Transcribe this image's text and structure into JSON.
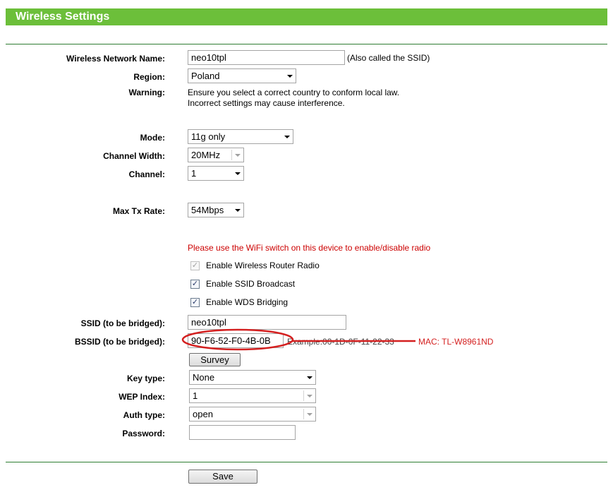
{
  "header": {
    "title": "Wireless Settings"
  },
  "fields": {
    "ssid_label": "Wireless Network Name:",
    "ssid_value": "neo10tpl",
    "ssid_hint": "(Also called the SSID)",
    "region_label": "Region:",
    "region_value": "Poland",
    "warning_label": "Warning:",
    "warning_line1": "Ensure you select a correct country to conform local law.",
    "warning_line2": "Incorrect settings may cause interference.",
    "mode_label": "Mode:",
    "mode_value": "11g only",
    "channel_width_label": "Channel Width:",
    "channel_width_value": "20MHz",
    "channel_label": "Channel:",
    "channel_value": "1",
    "max_tx_label": "Max Tx Rate:",
    "max_tx_value": "54Mbps",
    "wifi_switch_note": "Please use the WiFi switch on this device to enable/disable radio",
    "enable_radio_label": "Enable Wireless Router Radio",
    "enable_ssid_broadcast_label": "Enable SSID Broadcast",
    "enable_wds_label": "Enable WDS Bridging",
    "bridged_ssid_label": "SSID (to be bridged):",
    "bridged_ssid_value": "neo10tpl",
    "bssid_label": "BSSID (to be bridged):",
    "bssid_value": "90-F6-52-F0-4B-0B",
    "bssid_example": "Example:00-1D-0F-11-22-33",
    "survey_label": "Survey",
    "key_type_label": "Key type:",
    "key_type_value": "None",
    "wep_index_label": "WEP Index:",
    "wep_index_value": "1",
    "auth_type_label": "Auth type:",
    "auth_type_value": "open",
    "password_label": "Password:",
    "password_value": ""
  },
  "annotation": {
    "mac_note": "MAC: TL-W8961ND",
    "color": "#d42020"
  },
  "footer": {
    "save_label": "Save"
  },
  "checkboxes": {
    "enable_radio": true,
    "enable_ssid_broadcast": true,
    "enable_wds": true
  },
  "colors": {
    "header": "#6cbf3a",
    "divider": "#2e7d32",
    "warning": "#cc0000"
  }
}
